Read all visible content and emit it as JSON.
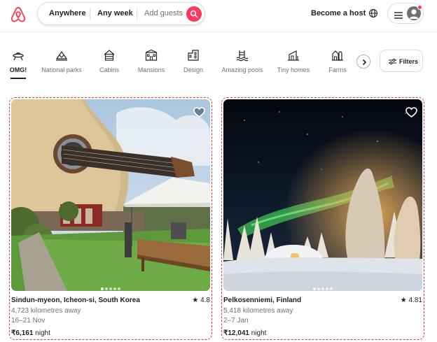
{
  "header": {
    "search": {
      "anywhere": "Anywhere",
      "any_week": "Any week",
      "add_guests": "Add guests"
    },
    "become_host": "Become a host"
  },
  "categories": [
    {
      "label": "OMG!",
      "icon": "ufo-icon",
      "active": true
    },
    {
      "label": "National parks",
      "icon": "national-park-icon",
      "active": false
    },
    {
      "label": "Cabins",
      "icon": "cabin-icon",
      "active": false
    },
    {
      "label": "Mansions",
      "icon": "mansion-icon",
      "active": false
    },
    {
      "label": "Design",
      "icon": "design-icon",
      "active": false
    },
    {
      "label": "Amazing pools",
      "icon": "pool-icon",
      "active": false
    },
    {
      "label": "Tiny homes",
      "icon": "tiny-home-icon",
      "active": false
    },
    {
      "label": "Farms",
      "icon": "farm-icon",
      "active": false
    }
  ],
  "filters_label": "Filters",
  "listings": [
    {
      "title": "Sindun-myeon, Icheon-si, South Korea",
      "rating": "4.8",
      "distance": "4,723 kilometres away",
      "dates": "16–21 Nov",
      "price": "₹6,161",
      "price_unit": " night",
      "favourited": true,
      "image": "guitar-shaped-house-photo"
    },
    {
      "title": "Pelkosenniemi, Finland",
      "rating": "4.81",
      "distance": "5,418 kilometres away",
      "dates": "2–7 Jan",
      "price": "₹12,041",
      "price_unit": " night",
      "favourited": false,
      "image": "igloo-northern-lights-photo"
    }
  ],
  "colors": {
    "brand": "#ff385c",
    "text": "#222222",
    "muted": "#717171"
  }
}
